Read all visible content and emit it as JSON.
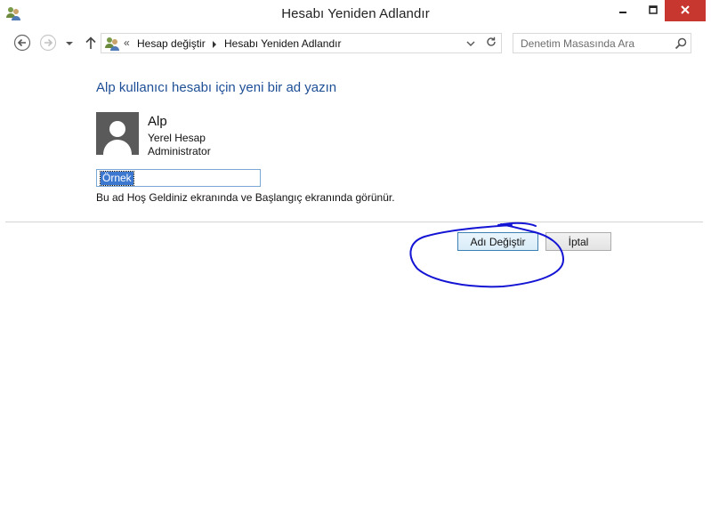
{
  "window": {
    "title": "Hesabı Yeniden Adlandır",
    "app_icon": "users-icon",
    "controls": [
      "minimize-icon",
      "maximize-icon",
      "close-icon"
    ],
    "close_color": "#c7372f"
  },
  "navigation": {
    "back_icon": "arrow-left-icon",
    "forward_icon": "arrow-right-icon",
    "recent_icon": "chevron-down-icon",
    "up_icon": "arrow-up-icon",
    "breadcrumb": {
      "overflow": "«",
      "items": [
        "Hesap değiştir",
        "Hesabı Yeniden Adlandır"
      ]
    },
    "refresh_icon": "refresh-icon",
    "search_placeholder": "Denetim Masasında Ara",
    "search_icon": "search-icon"
  },
  "main": {
    "heading": "Alp kullanıcı hesabı için yeni bir ad yazın",
    "heading_color": "#1e4f96",
    "account": {
      "name": "Alp",
      "type": "Yerel Hesap",
      "role": "Administrator",
      "avatar_icon": "user-silhouette-icon"
    },
    "name_field_value": "Örnek",
    "hint": "Bu ad Hoş Geldiniz ekranında ve Başlangıç ekranında görünür.",
    "buttons": {
      "rename": "Adı Değiştir",
      "cancel": "İptal"
    }
  },
  "annotation": {
    "type": "hand-drawn circle",
    "color": "#1414d4",
    "target": "Adı Değiştir"
  }
}
